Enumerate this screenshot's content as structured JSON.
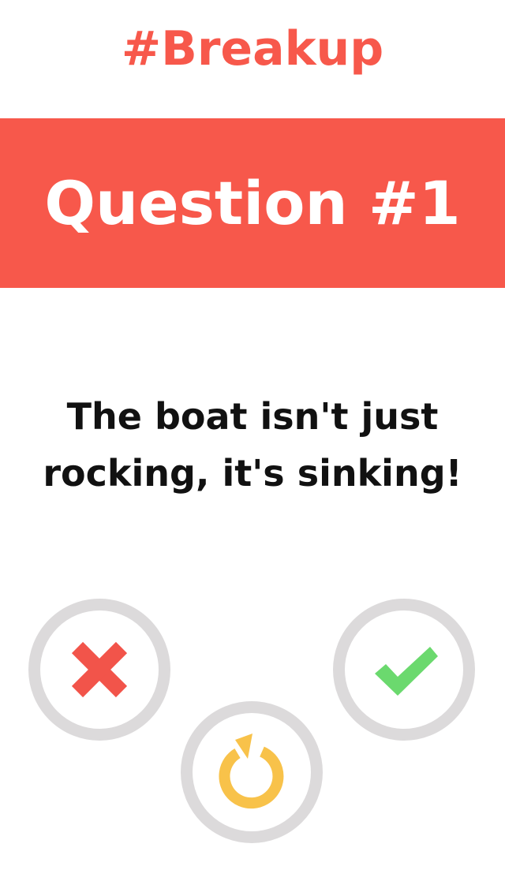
{
  "header": {
    "title": "#Breakup"
  },
  "banner": {
    "label": "Question #1",
    "color": "#f7584b"
  },
  "question": {
    "text": "The boat isn't just rocking, it's sinking!"
  },
  "actions": {
    "reject": {
      "icon": "x-icon",
      "color": "#f2544a"
    },
    "accept": {
      "icon": "checkmark-icon",
      "color": "#6bd96e"
    },
    "reset": {
      "icon": "refresh-icon",
      "color": "#f8c24a"
    },
    "ring_color": "#dcdadb"
  }
}
